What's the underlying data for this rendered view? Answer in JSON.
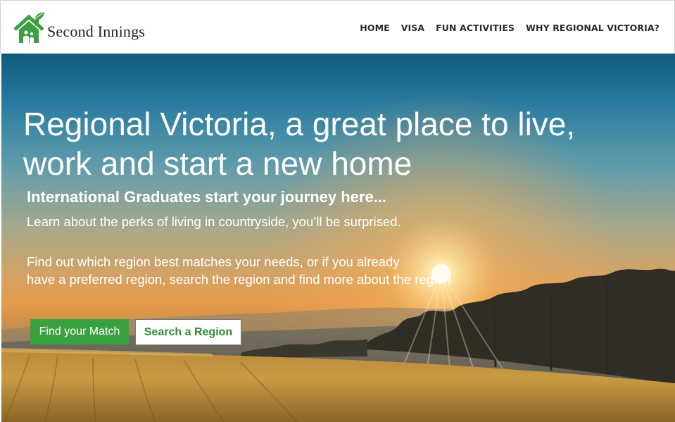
{
  "brand": {
    "name": "Second Innings",
    "icon": "house-leaf-icon",
    "colors": {
      "green": "#3aa141",
      "dark": "#222222"
    }
  },
  "nav": {
    "items": [
      {
        "label": "HOME"
      },
      {
        "label": "VISA"
      },
      {
        "label": "FUN ACTIVITIES"
      },
      {
        "label": "WHY REGIONAL VICTORIA?"
      }
    ]
  },
  "hero": {
    "title_line1": "Regional Victoria, a great place to live,",
    "title_line2": "work and start a new home",
    "subtitle": "International Graduates start your journey here...",
    "text1": "Learn about the perks of living in countryside, you’ll be surprised.",
    "text2_line1": "Find out which region best matches your needs, or if you already",
    "text2_line2": "have a preferred region, search the region and find more about the region",
    "buttons": {
      "match": "Find your Match",
      "search": "Search a Region"
    },
    "background": "sunset-field-image"
  }
}
